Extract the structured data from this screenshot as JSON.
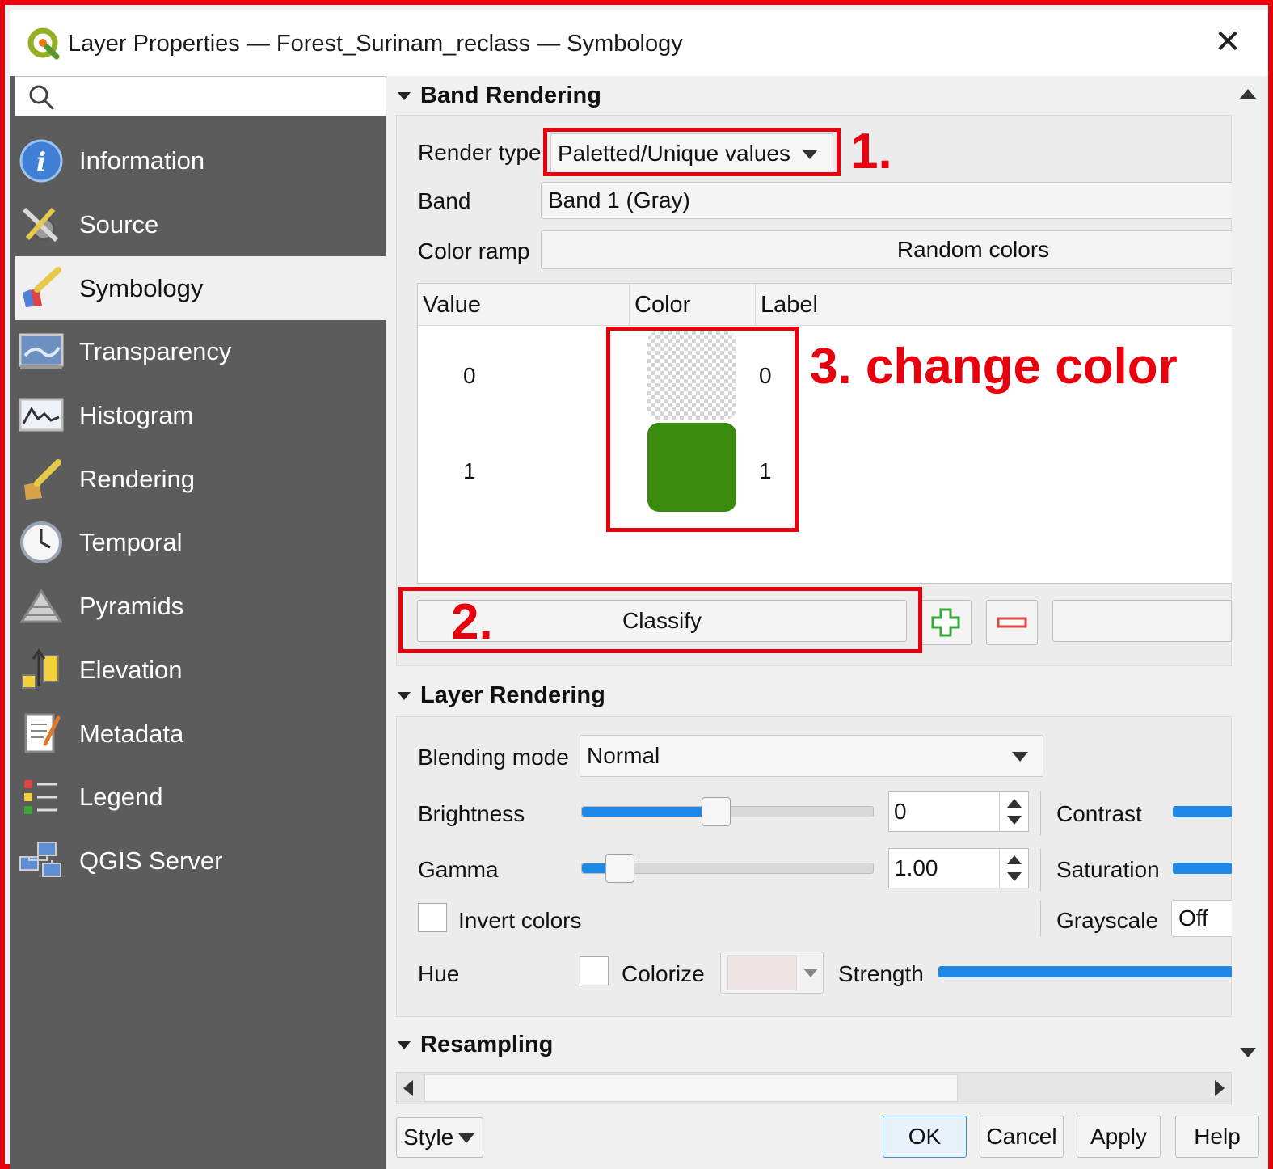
{
  "window": {
    "title": "Layer Properties — Forest_Surinam_reclass — Symbology",
    "close_glyph": "✕"
  },
  "sidebar": {
    "search_placeholder": "",
    "items": [
      {
        "label": "Information",
        "icon": "information-icon"
      },
      {
        "label": "Source",
        "icon": "source-tools-icon"
      },
      {
        "label": "Symbology",
        "icon": "symbology-brush-icon",
        "active": true
      },
      {
        "label": "Transparency",
        "icon": "transparency-icon"
      },
      {
        "label": "Histogram",
        "icon": "histogram-icon"
      },
      {
        "label": "Rendering",
        "icon": "rendering-brush-icon"
      },
      {
        "label": "Temporal",
        "icon": "clock-icon"
      },
      {
        "label": "Pyramids",
        "icon": "pyramids-icon"
      },
      {
        "label": "Elevation",
        "icon": "elevation-icon"
      },
      {
        "label": "Metadata",
        "icon": "metadata-icon"
      },
      {
        "label": "Legend",
        "icon": "legend-icon"
      },
      {
        "label": "QGIS Server",
        "icon": "server-icon"
      }
    ]
  },
  "band_rendering": {
    "heading": "Band Rendering",
    "render_type_label": "Render type",
    "render_type_value": "Paletted/Unique values",
    "band_label": "Band",
    "band_value": "Band 1 (Gray)",
    "color_ramp_label": "Color ramp",
    "color_ramp_value": "Random colors",
    "table": {
      "headers": [
        "Value",
        "Color",
        "Label"
      ],
      "rows": [
        {
          "value": "0",
          "color": "transparent",
          "label": "0"
        },
        {
          "value": "1",
          "color": "#3a8a0c",
          "label": "1"
        }
      ]
    },
    "classify_label": "Classify",
    "add_glyph": "+",
    "remove_glyph": "−"
  },
  "annotations": {
    "step1": "1.",
    "step2": "2.",
    "step3": "3. change color",
    "color": "#e8000d"
  },
  "layer_rendering": {
    "heading": "Layer Rendering",
    "blending_mode_label": "Blending mode",
    "blending_mode_value": "Normal",
    "brightness_label": "Brightness",
    "brightness_value": "0",
    "contrast_label": "Contrast",
    "gamma_label": "Gamma",
    "gamma_value": "1.00",
    "saturation_label": "Saturation",
    "invert_colors_label": "Invert colors",
    "grayscale_label": "Grayscale",
    "grayscale_value": "Off",
    "hue_label": "Hue",
    "colorize_label": "Colorize",
    "strength_label": "Strength",
    "brightness_level": 0.46,
    "gamma_level": 0.13
  },
  "resampling": {
    "heading": "Resampling"
  },
  "footer": {
    "style_label": "Style",
    "ok_label": "OK",
    "cancel_label": "Cancel",
    "apply_label": "Apply",
    "help_label": "Help"
  },
  "colors": {
    "accent": "#1e88e5",
    "sidebar_bg": "#5c5c5c",
    "green_swatch": "#3a8a0c"
  }
}
